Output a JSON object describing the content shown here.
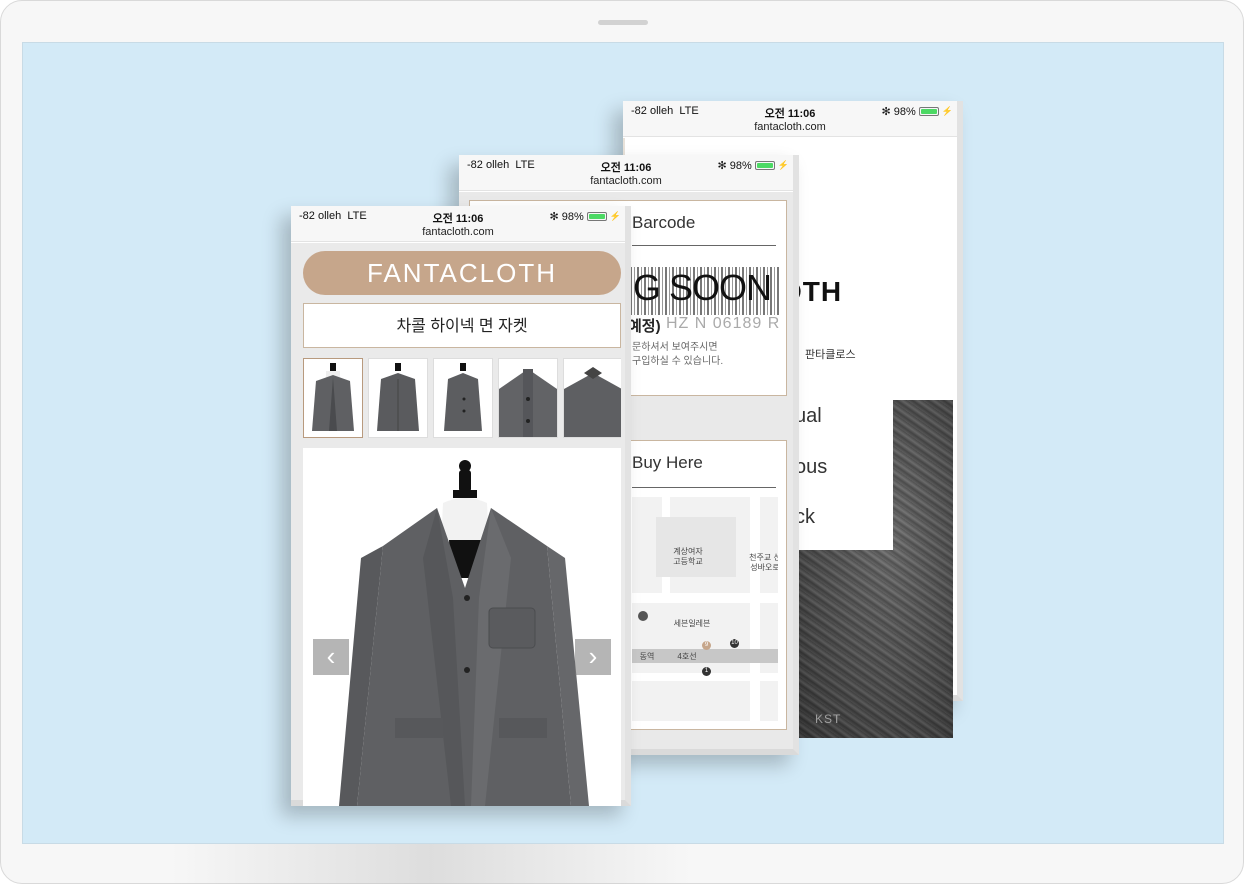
{
  "status": {
    "carrier": "-82 olleh",
    "network": "LTE",
    "time": "오전 11:06",
    "bluetooth": "✻",
    "battery": "98%",
    "bolt": "⚡",
    "url": "fantacloth.com"
  },
  "phone3": {
    "logo_partial": "OTH",
    "logo_sub": "판타클로스",
    "menu": [
      "ual",
      "ous",
      "ck"
    ],
    "photo_text": "KST"
  },
  "phone2": {
    "barcode_title": "Barcode",
    "coming_soon": "G SOON",
    "barcode_sub": "예정)",
    "barcode_code": "HZ N 06189 R",
    "barcode_note": [
      "문하셔서 보여주시면",
      "구입하실 수 있습니다."
    ],
    "buy_title": "Buy Here",
    "map": {
      "school": [
        "계상여자",
        "고등학교"
      ],
      "church": [
        "천주교 선",
        "성바오로"
      ],
      "store": "세븐일레븐",
      "station": "동역",
      "line": "4호선",
      "exit_9": "9",
      "exit_10": "10",
      "exit_1": "1"
    }
  },
  "phone1": {
    "brand": "FANTACLOTH",
    "product_title": "차콜 하이넥 면 자켓",
    "prev_arrow": "‹",
    "next_arrow": "›"
  },
  "colors": {
    "brand": "#c6a68b",
    "border": "#c9b6a0",
    "screen_bg": "#d3eaf7",
    "jacket": "#5f6063"
  }
}
